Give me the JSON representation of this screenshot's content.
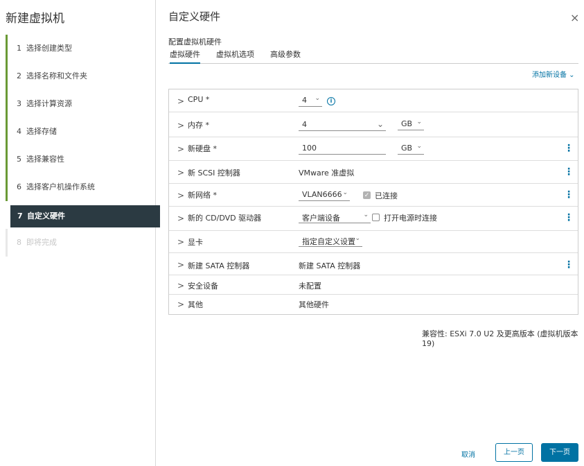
{
  "wizard": {
    "title": "新建虚拟机",
    "steps": [
      {
        "num": "1",
        "label": "选择创建类型"
      },
      {
        "num": "2",
        "label": "选择名称和文件夹"
      },
      {
        "num": "3",
        "label": "选择计算资源"
      },
      {
        "num": "4",
        "label": "选择存储"
      },
      {
        "num": "5",
        "label": "选择兼容性"
      },
      {
        "num": "6",
        "label": "选择客户机操作系统"
      },
      {
        "num": "7",
        "label": "自定义硬件"
      },
      {
        "num": "8",
        "label": "即将完成"
      }
    ]
  },
  "page": {
    "title": "自定义硬件",
    "close_icon": "×",
    "subtitle": "配置虚拟机硬件",
    "tabs": [
      "虚拟硬件",
      "虚拟机选项",
      "高级参数"
    ],
    "add_device": "添加新设备 ⌄"
  },
  "hardware": {
    "cpu": {
      "label": "CPU *",
      "value": "4"
    },
    "memory": {
      "label": "内存 *",
      "value": "4",
      "unit": "GB"
    },
    "disk": {
      "label": "新硬盘 *",
      "value": "100",
      "unit": "GB"
    },
    "scsi": {
      "label": "新 SCSI 控制器",
      "value": "VMware 准虚拟"
    },
    "network": {
      "label": "新网络 *",
      "value": "VLAN6666",
      "connected_label": "已连接"
    },
    "cdrom": {
      "label": "新的 CD/DVD 驱动器",
      "value": "客户端设备",
      "power_on_label": "打开电源时连接"
    },
    "video": {
      "label": "显卡",
      "value": "指定自定义设置"
    },
    "sata": {
      "label": "新建 SATA 控制器",
      "value": "新建 SATA 控制器"
    },
    "security": {
      "label": "安全设备",
      "value": "未配置"
    },
    "other": {
      "label": "其他",
      "value": "其他硬件"
    }
  },
  "compat": "兼容性: ESXi 7.0 U2 及更高版本 (虚拟机版本 19)",
  "footer": {
    "cancel": "取消",
    "back": "上一页",
    "next": "下一页"
  },
  "colors": {
    "accent": "#0072a3",
    "active_step": "#2b3a42",
    "step_bar": "#6a9a35"
  },
  "icons": {
    "chevron": "chevron-right-icon",
    "kebab": "vertical-ellipsis-icon",
    "info": "info-icon",
    "close": "close-icon"
  }
}
